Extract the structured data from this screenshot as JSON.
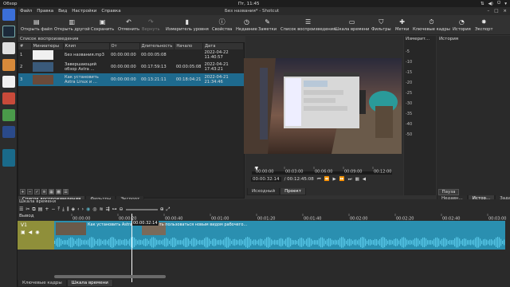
{
  "system_bar": {
    "activities": "Обзор",
    "clock": "Пт, 11:45"
  },
  "window": {
    "title": "Без названия* - Shotcut",
    "menu": [
      "Файл",
      "Правка",
      "Вид",
      "Настройки",
      "Справка"
    ]
  },
  "toolbar": [
    {
      "icon": "folder-open-icon",
      "label": "Открыть файл",
      "disabled": false
    },
    {
      "icon": "open-other-icon",
      "label": "Открыть другой",
      "disabled": false
    },
    {
      "icon": "save-icon",
      "label": "Сохранить",
      "disabled": false
    },
    {
      "icon": "undo-icon",
      "label": "Отменить",
      "disabled": false
    },
    {
      "icon": "redo-icon",
      "label": "Вернуть",
      "disabled": true
    },
    {
      "icon": "level-meter-icon",
      "label": "Измеритель уровня",
      "disabled": false
    },
    {
      "icon": "properties-icon",
      "label": "Свойства",
      "disabled": false
    },
    {
      "icon": "history-icon",
      "label": "Недавние",
      "disabled": false
    },
    {
      "icon": "notes-icon",
      "label": "Заметки",
      "disabled": false
    },
    {
      "icon": "playlist-icon",
      "label": "Список воспроизведения",
      "disabled": false
    },
    {
      "icon": "timeline-icon",
      "label": "Шкала времени",
      "disabled": false
    },
    {
      "icon": "filters-icon",
      "label": "Фильтры",
      "disabled": false
    },
    {
      "icon": "markers-icon",
      "label": "Метки",
      "disabled": false
    },
    {
      "icon": "keyframes-icon",
      "label": "Ключевые кадры",
      "disabled": false
    },
    {
      "icon": "clock-icon",
      "label": "История",
      "disabled": false
    },
    {
      "icon": "export-icon",
      "label": "Экспорт",
      "disabled": false
    }
  ],
  "playlist": {
    "title": "Список воспроизведения",
    "columns": [
      "#",
      "Миниатюры",
      "Клип",
      "От",
      "Длительность",
      "Начало",
      "Дата"
    ],
    "rows": [
      {
        "num": "1",
        "clip": "Без названия.mp3",
        "in": "00:00:00:00",
        "duration": "00:00:05:08",
        "start": "",
        "date": "2022-04-22 11:40:57",
        "thumb": "#f0f0f0",
        "selected": false
      },
      {
        "num": "2",
        "clip": "Завершающий обзор Astra ...",
        "in": "00:00:00:00",
        "duration": "00:17:59:13",
        "start": "00:00:05:08",
        "date": "2022-04-21 17:43:21",
        "thumb": "#3a5a7a",
        "selected": false
      },
      {
        "num": "3",
        "clip": "Как установить Astra Linux и ...",
        "in": "00:00:00:00",
        "duration": "00:13:21:11",
        "start": "00:18:04:21",
        "date": "2022-04-21 21:34:46",
        "thumb": "#6a4a3a",
        "selected": true
      }
    ],
    "tabs": [
      "Список воспроизведения",
      "Фильтры",
      "Экспорт"
    ]
  },
  "player": {
    "ruler": [
      "00:00:00",
      "00:03:00",
      "00:06:00",
      "00:09:00",
      "00:12:00"
    ],
    "current_time": "00:00:32:14",
    "total_time": "00:12:45:08",
    "tabs": [
      "Исходный",
      "Проект"
    ]
  },
  "audio_meter": {
    "title": "Измерит...",
    "scale": [
      "-5",
      "-10",
      "-15",
      "-20",
      "-25",
      "-30",
      "-35",
      "-40",
      "-50"
    ]
  },
  "right_panel": {
    "title": "История",
    "pause_label": "Пауза",
    "tabs": [
      "Недавн...",
      "Истор...",
      "Задан..."
    ]
  },
  "timeline": {
    "title": "Шкала времени",
    "output_label": "Вывод",
    "track_label": "V1",
    "ruler": [
      "00:00:00",
      "00:00:20",
      "00:00:40",
      "00:01:00",
      "00:01:20",
      "00:01:40",
      "00:02:00",
      "00:02:20",
      "00:02:40",
      "00:03:00"
    ],
    "clip_title": "Как установить Astra Linux и начать пользоваться новым видом рабочего...",
    "playhead_label": "00:00:32:14"
  },
  "bottom_tabs": [
    "Ключевые кадры",
    "Шкала времени"
  ],
  "colors": {
    "accent": "#1e6a8e",
    "clip": "#2a8fb0",
    "waveform": "#58c8e8",
    "track_header": "#8f8f3a"
  }
}
